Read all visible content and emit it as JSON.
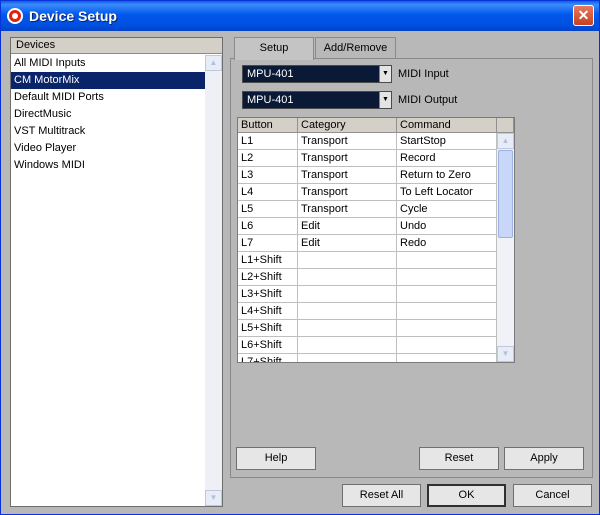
{
  "window": {
    "title": "Device Setup",
    "close_glyph": "✕"
  },
  "devices": {
    "header": "Devices",
    "items": [
      {
        "label": "All MIDI Inputs",
        "selected": false
      },
      {
        "label": "CM MotorMix",
        "selected": true
      },
      {
        "label": "Default MIDI Ports",
        "selected": false
      },
      {
        "label": "DirectMusic",
        "selected": false
      },
      {
        "label": "VST Multitrack",
        "selected": false
      },
      {
        "label": "Video Player",
        "selected": false
      },
      {
        "label": "Windows MIDI",
        "selected": false
      }
    ]
  },
  "tabs": [
    {
      "label": "Setup",
      "active": true
    },
    {
      "label": "Add/Remove",
      "active": false
    }
  ],
  "midi_input": {
    "value": "MPU-401",
    "label": "MIDI Input"
  },
  "midi_output": {
    "value": "MPU-401",
    "label": "MIDI Output"
  },
  "table": {
    "columns": [
      "Button",
      "Category",
      "Command"
    ],
    "rows": [
      [
        "L1",
        "Transport",
        "StartStop"
      ],
      [
        "L2",
        "Transport",
        "Record"
      ],
      [
        "L3",
        "Transport",
        "Return to Zero"
      ],
      [
        "L4",
        "Transport",
        "To Left Locator"
      ],
      [
        "L5",
        "Transport",
        "Cycle"
      ],
      [
        "L6",
        "Edit",
        "Undo"
      ],
      [
        "L7",
        "Edit",
        "Redo"
      ],
      [
        "L1+Shift",
        "",
        ""
      ],
      [
        "L2+Shift",
        "",
        ""
      ],
      [
        "L3+Shift",
        "",
        ""
      ],
      [
        "L4+Shift",
        "",
        ""
      ],
      [
        "L5+Shift",
        "",
        ""
      ],
      [
        "L6+Shift",
        "",
        ""
      ],
      [
        "L7+Shift",
        "",
        ""
      ]
    ]
  },
  "panel_buttons": {
    "help": "Help",
    "reset": "Reset",
    "apply": "Apply"
  },
  "dialog_buttons": {
    "reset_all": "Reset All",
    "ok": "OK",
    "cancel": "Cancel"
  },
  "icons": {
    "up": "▲",
    "down": "▼",
    "dropdown": "▼"
  }
}
